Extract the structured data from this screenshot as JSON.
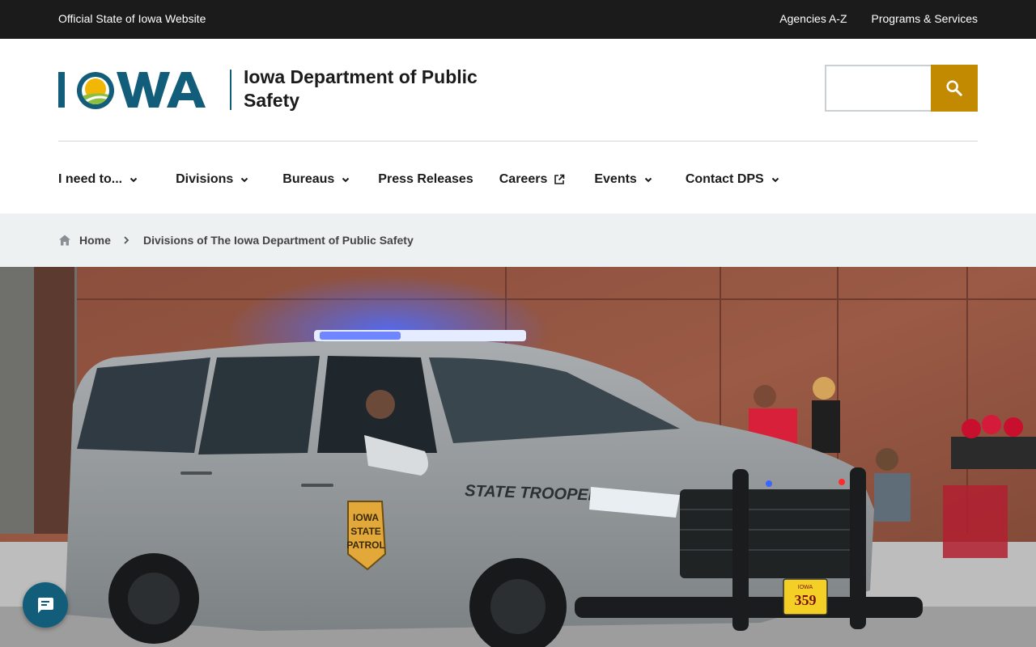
{
  "topbar": {
    "official_label": "Official State of Iowa Website",
    "links": [
      "Agencies A-Z",
      "Programs & Services"
    ]
  },
  "header": {
    "logo_text": "IOWA",
    "department_name": "Iowa Department of Public Safety",
    "search": {
      "value": "",
      "placeholder": ""
    }
  },
  "nav": {
    "items": [
      {
        "label": "I need to..."
      },
      {
        "label": "Divisions"
      },
      {
        "label": "Bureaus"
      },
      {
        "label": "Press Releases"
      },
      {
        "label": "Careers"
      },
      {
        "label": "Events"
      },
      {
        "label": "Contact DPS"
      }
    ]
  },
  "breadcrumb": {
    "home": "Home",
    "current": "Divisions of The Iowa Department of Public Safety"
  },
  "hero": {
    "vehicle_text": "STATE TROOPER",
    "badge_lines": [
      "IOWA",
      "STATE",
      "PATROL"
    ],
    "plate_number": "359",
    "plate_state": "IOWA"
  },
  "colors": {
    "topbar_bg": "#1b1b1b",
    "brand_teal": "#125e7a",
    "search_gold": "#c28a00",
    "breadcrumb_bg": "#eef1f2"
  },
  "icons": {
    "search": "search-icon",
    "chevron": "chevron-down-icon",
    "external": "external-link-icon",
    "home": "home-icon",
    "chat": "chat-icon"
  }
}
